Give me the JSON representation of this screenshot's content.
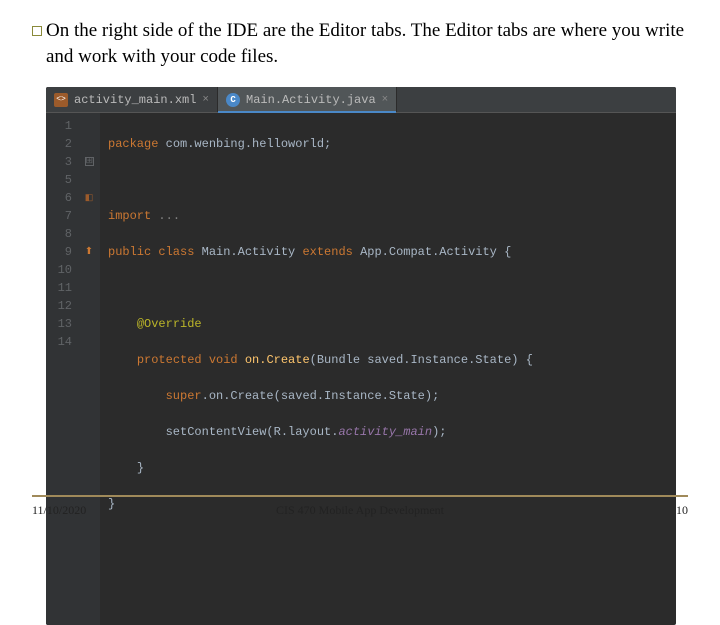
{
  "slide": {
    "body_text": "On the right side of the IDE are the Editor tabs. The Editor tabs are where you write and work with your code files."
  },
  "ide": {
    "tabs": [
      {
        "icon_label": "<>",
        "name": "activity_main.xml",
        "close": "×",
        "active": false
      },
      {
        "icon_label": "C",
        "name": "Main.Activity.java",
        "close": "×",
        "active": true
      }
    ],
    "gutter_lines": [
      "1",
      "2",
      "3",
      "5",
      "6",
      "7",
      "8",
      "9",
      "10",
      "11",
      "12",
      "13",
      "14"
    ],
    "gutter_extra": {
      "line3": "⊞",
      "line5": "⊟",
      "line6_icon": "xml-link-icon",
      "line9_icon": "override-up-icon"
    },
    "code": {
      "l1_kw": "package",
      "l1_pkg": " com.wenbing.helloworld;",
      "l3_kw": "import",
      "l3_fold": " ...",
      "l5_kw1": "public class ",
      "l5_cls": "Main.Activity",
      "l5_kw2": " extends ",
      "l5_sup": "App.Compat.Activity",
      "l5_brace": " {",
      "l7_ann": "@Override",
      "l8_kw": "protected void ",
      "l8_mth": "on.Create",
      "l8_sig": "(Bundle saved.Instance.State) {",
      "l9_super": "super",
      "l9_call": ".on.Create(saved.Instance.State);",
      "l10_call1": "setContentView(R.layout.",
      "l10_field": "activity_main",
      "l10_call2": ");",
      "l11_brace": "}",
      "l12_brace": "}"
    }
  },
  "footer": {
    "date": "11/10/2020",
    "course": "CIS 470 Mobile App Development",
    "page": "10"
  }
}
